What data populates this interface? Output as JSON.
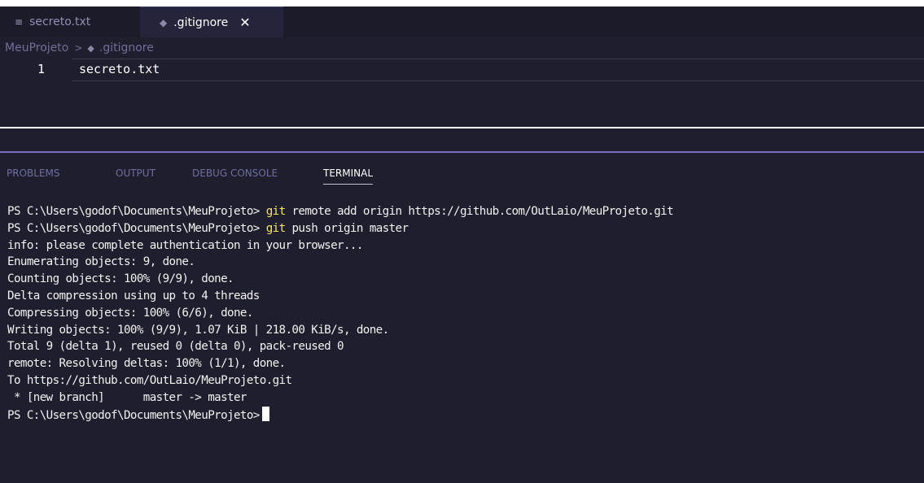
{
  "tabs": [
    {
      "icon": "lines-icon",
      "label": "secreto.txt",
      "active": false
    },
    {
      "icon": "git-diamond-icon",
      "label": ".gitignore",
      "active": true
    }
  ],
  "breadcrumb": {
    "project": "MeuProjeto",
    "separator": ">",
    "file": ".gitignore"
  },
  "editor": {
    "line_number": "1",
    "content": "secreto.txt"
  },
  "panel_tabs": [
    "PROBLEMS",
    "OUTPUT",
    "DEBUG CONSOLE",
    "TERMINAL"
  ],
  "terminal": {
    "prompt": "PS C:\\Users\\godof\\Documents\\MeuProjeto>",
    "cmd1": {
      "exe": "git",
      "args": "remote add origin https://github.com/OutLaio/MeuProjeto.git"
    },
    "cmd2": {
      "exe": "git",
      "args": "push origin master"
    },
    "output": [
      "info: please complete authentication in your browser...",
      "Enumerating objects: 9, done.",
      "Counting objects: 100% (9/9), done.",
      "Delta compression using up to 4 threads",
      "Compressing objects: 100% (6/6), done.",
      "Writing objects: 100% (9/9), 1.07 KiB | 218.00 KiB/s, done.",
      "Total 9 (delta 1), reused 0 (delta 0), pack-reused 0",
      "remote: Resolving deltas: 100% (1/1), done.",
      "To https://github.com/OutLaio/MeuProjeto.git",
      " * [new branch]      master -> master"
    ]
  },
  "colors": {
    "accent": "#7b6fc4",
    "command": "#f5e56b",
    "background": "#1e1e2e"
  }
}
